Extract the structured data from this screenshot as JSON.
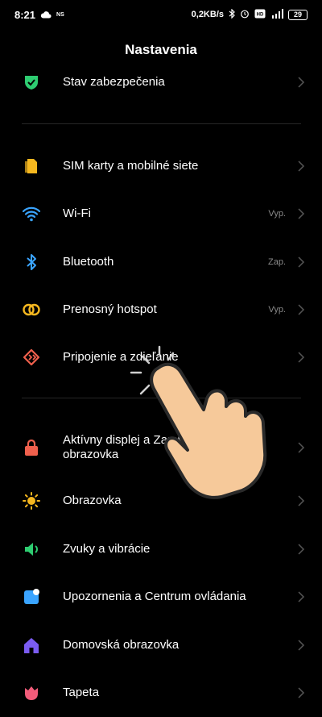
{
  "status_bar": {
    "time": "8:21",
    "ns": "NS",
    "speed": "0,2KB/s",
    "battery": "29",
    "icons": [
      "cloud-icon",
      "bluetooth-icon",
      "alarm-icon",
      "volte-icon",
      "signal-icon"
    ]
  },
  "header": {
    "title": "Nastavenia"
  },
  "rows": [
    {
      "label": "Stav zabezpečenia",
      "value": "",
      "icon": "shield-icon",
      "color": "#2ecc71"
    },
    {
      "label": "SIM karty a mobilné siete",
      "value": "",
      "icon": "sim-icon",
      "color": "#f5b71f"
    },
    {
      "label": "Wi-Fi",
      "value": "Vyp.",
      "icon": "wifi-icon",
      "color": "#3aa4ff"
    },
    {
      "label": "Bluetooth",
      "value": "Zap.",
      "icon": "bluetooth-icon",
      "color": "#3aa4ff"
    },
    {
      "label": "Prenosný hotspot",
      "value": "Vyp.",
      "icon": "hotspot-icon",
      "color": "#f5b71f"
    },
    {
      "label": "Pripojenie a zdieľanie",
      "value": "",
      "icon": "connection-sharing-icon",
      "color": "#f0604d"
    },
    {
      "label": "Aktívny displej a Zamknutá obrazovka",
      "value": "",
      "icon": "lock-icon",
      "color": "#f0604d"
    },
    {
      "label": "Obrazovka",
      "value": "",
      "icon": "sun-icon",
      "color": "#f5b71f"
    },
    {
      "label": "Zvuky a vibrácie",
      "value": "",
      "icon": "speaker-icon",
      "color": "#2ecc71"
    },
    {
      "label": "Upozornenia a Centrum ovládania",
      "value": "",
      "icon": "notification-icon",
      "color": "#3aa4ff"
    },
    {
      "label": "Domovská obrazovka",
      "value": "",
      "icon": "home-icon",
      "color": "#7b5cf2"
    },
    {
      "label": "Tapeta",
      "value": "",
      "icon": "wallpaper-icon",
      "color": "#f25c7a"
    }
  ]
}
